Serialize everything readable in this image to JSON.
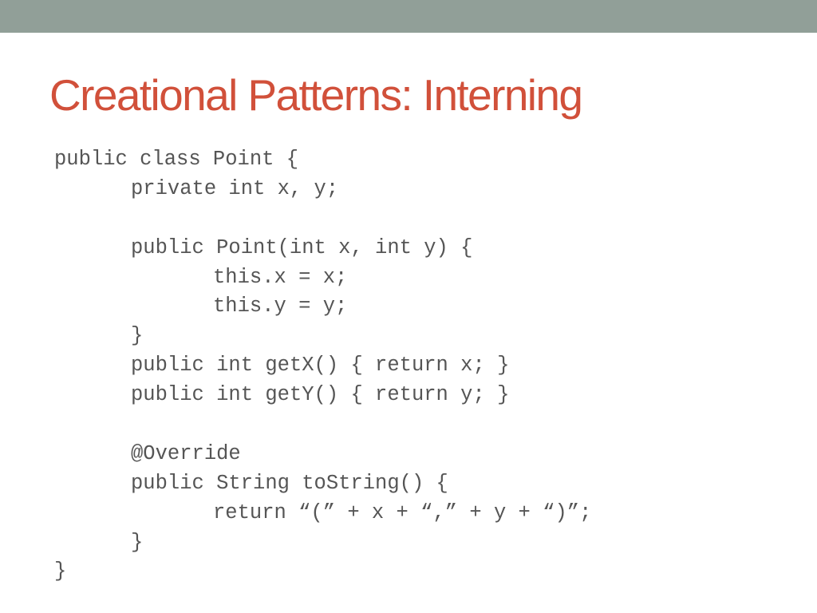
{
  "slide": {
    "title": "Creational Patterns: Interning",
    "accent_color": "#d1503a",
    "top_bar_color": "#919f98",
    "code_language": "java",
    "code_lines": [
      {
        "indent": 0,
        "text": "public class Point {"
      },
      {
        "indent": 1,
        "text": "private int x, y;"
      },
      {
        "indent": 0,
        "text": ""
      },
      {
        "indent": 1,
        "text": "public Point(int x, int y) {"
      },
      {
        "indent": 2,
        "text": "this.x = x;"
      },
      {
        "indent": 2,
        "text": "this.y = y;"
      },
      {
        "indent": 1,
        "text": "}"
      },
      {
        "indent": 1,
        "text": "public int getX() { return x; }"
      },
      {
        "indent": 1,
        "text": "public int getY() { return y; }"
      },
      {
        "indent": 0,
        "text": ""
      },
      {
        "indent": 1,
        "text": "@Override"
      },
      {
        "indent": 1,
        "text": "public String toString() {"
      },
      {
        "indent": 2,
        "text": "return “(” + x + “,” + y + “)”;"
      },
      {
        "indent": 1,
        "text": "}"
      },
      {
        "indent": 0,
        "text": "}"
      }
    ]
  }
}
